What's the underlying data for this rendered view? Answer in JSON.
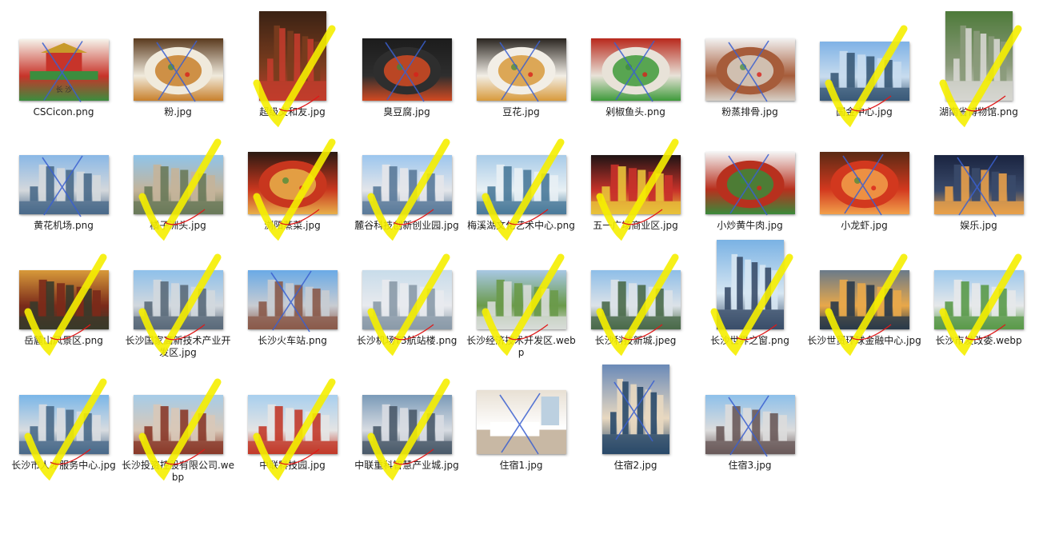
{
  "window": {
    "view": "large-icons"
  },
  "colors": {
    "highlight": "#f5ee00",
    "pen_blue": "#3a5fd0",
    "pen_red": "#e01818"
  },
  "files": [
    {
      "name": "CSCicon.png",
      "kind": "logo",
      "mark": "x",
      "colors": [
        "#f6f3ea",
        "#c7342a",
        "#3c8d3e"
      ]
    },
    {
      "name": "粉.jpg",
      "kind": "food",
      "mark": "x",
      "colors": [
        "#5a3a1e",
        "#f0eadc",
        "#c8802c"
      ]
    },
    {
      "name": "超级文和友.jpg",
      "kind": "tall",
      "mark": "check",
      "colors": [
        "#3a2214",
        "#7a3c1e",
        "#c23c2c"
      ]
    },
    {
      "name": "臭豆腐.jpg",
      "kind": "food",
      "mark": "x",
      "colors": [
        "#1c1c1c",
        "#2e2e2e",
        "#d24a22"
      ]
    },
    {
      "name": "豆花.jpg",
      "kind": "food",
      "mark": "x",
      "colors": [
        "#2a2520",
        "#f2eee6",
        "#d89a3c"
      ]
    },
    {
      "name": "剁椒鱼头.png",
      "kind": "food",
      "mark": "x",
      "colors": [
        "#b8281c",
        "#e8e2d8",
        "#3e9a3a"
      ]
    },
    {
      "name": "粉蒸排骨.jpg",
      "kind": "food",
      "mark": "x",
      "colors": [
        "#f2f2f2",
        "#a65c3a",
        "#d7d0c6"
      ]
    },
    {
      "name": "国金中心.jpg",
      "kind": "city",
      "mark": "check",
      "colors": [
        "#7fb2e6",
        "#c8dcee",
        "#3a5a78"
      ]
    },
    {
      "name": "湖南省博物馆.png",
      "kind": "tall",
      "mark": "check",
      "colors": [
        "#4e7a3a",
        "#8a9a7a",
        "#d6d6d0"
      ]
    },
    {
      "name": "黄花机场.png",
      "kind": "city",
      "mark": "x",
      "colors": [
        "#8ab8e6",
        "#d4d8dc",
        "#4a6a8a"
      ]
    },
    {
      "name": "橘子洲头.jpg",
      "kind": "city",
      "mark": "check",
      "colors": [
        "#8fc4ea",
        "#c4b49a",
        "#6a7a5a"
      ]
    },
    {
      "name": "浏阳蒸菜.jpg",
      "kind": "food",
      "mark": "check",
      "colors": [
        "#2a1a12",
        "#c8361e",
        "#e8b04a"
      ]
    },
    {
      "name": "麓谷科技创新创业园.jpg",
      "kind": "city",
      "mark": "check",
      "colors": [
        "#9cc6ee",
        "#e4e6ea",
        "#5a7a9a"
      ]
    },
    {
      "name": "梅溪湖文化艺术中心.png",
      "kind": "city",
      "mark": "check",
      "colors": [
        "#a8cbe8",
        "#e8f0f4",
        "#4a7a9a"
      ]
    },
    {
      "name": "五一广场商业区.jpg",
      "kind": "city",
      "mark": "check",
      "colors": [
        "#1e1414",
        "#c8322a",
        "#e8c23a"
      ]
    },
    {
      "name": "小炒黄牛肉.jpg",
      "kind": "food",
      "mark": "x",
      "colors": [
        "#f4f4f4",
        "#b8301e",
        "#3a8a3a"
      ]
    },
    {
      "name": "小龙虾.jpg",
      "kind": "food",
      "mark": "x",
      "colors": [
        "#5a2a14",
        "#d2381e",
        "#f2a04a"
      ]
    },
    {
      "name": "娱乐.jpg",
      "kind": "city",
      "mark": "x",
      "colors": [
        "#1a2440",
        "#3a4a6a",
        "#e8a04a"
      ]
    },
    {
      "name": "岳麓山风景区.png",
      "kind": "city",
      "mark": "check",
      "colors": [
        "#d89a3a",
        "#7a2a1a",
        "#3a3a2a"
      ]
    },
    {
      "name": "长沙国家高新技术产业开发区.jpg",
      "kind": "city",
      "mark": "check",
      "colors": [
        "#8ec0ea",
        "#d2d8de",
        "#5a6a7a"
      ]
    },
    {
      "name": "长沙火车站.png",
      "kind": "city",
      "mark": "x",
      "colors": [
        "#6aaae6",
        "#c8ccd2",
        "#8a5a4a"
      ]
    },
    {
      "name": "长沙机场T3航站楼.png",
      "kind": "city",
      "mark": "check",
      "colors": [
        "#c8dcea",
        "#e8eaee",
        "#8a9aa8"
      ]
    },
    {
      "name": "长沙经济技术开发区.webp",
      "kind": "city",
      "mark": "check",
      "colors": [
        "#a8c8e4",
        "#6a9a4a",
        "#d8dcd8"
      ]
    },
    {
      "name": "长沙科技新城.jpeg",
      "kind": "city",
      "mark": "check",
      "colors": [
        "#8ebee8",
        "#dce2e8",
        "#4a6a4a"
      ]
    },
    {
      "name": "长沙世界之窗.png",
      "kind": "tall",
      "mark": "check",
      "colors": [
        "#7ab2e4",
        "#d6e6f2",
        "#3a4e6a"
      ]
    },
    {
      "name": "长沙世贸环球金融中心.jpg",
      "kind": "city",
      "mark": "check",
      "colors": [
        "#6a7a8a",
        "#e8a84a",
        "#2a3a4a"
      ]
    },
    {
      "name": "长沙市发改委.webp",
      "kind": "city",
      "mark": "check",
      "colors": [
        "#9cc8ec",
        "#e6e8ea",
        "#5a9a4a"
      ]
    },
    {
      "name": "长沙市人才服务中心.jpg",
      "kind": "city",
      "mark": "check",
      "colors": [
        "#7ab6e8",
        "#d8dce0",
        "#4a6a8a"
      ]
    },
    {
      "name": "长沙投资控股有限公司.webp",
      "kind": "city",
      "mark": "check",
      "colors": [
        "#a6cce8",
        "#d8c8b8",
        "#8a3a2a"
      ]
    },
    {
      "name": "中联科技园.jpg",
      "kind": "city",
      "mark": "check",
      "colors": [
        "#a8cfee",
        "#e4e4e4",
        "#c23a2a"
      ]
    },
    {
      "name": "中联重科智慧产业城.jpg",
      "kind": "city",
      "mark": "check",
      "colors": [
        "#7a9ab8",
        "#d8dce2",
        "#4a5a6a"
      ]
    },
    {
      "name": "住宿1.jpg",
      "kind": "room",
      "mark": "x",
      "colors": [
        "#e8e0d4",
        "#ffffff",
        "#8a7a6a"
      ]
    },
    {
      "name": "住宿2.jpg",
      "kind": "tall",
      "mark": "x",
      "colors": [
        "#6a8ab8",
        "#e8d8c0",
        "#2a4a6a"
      ]
    },
    {
      "name": "住宿3.jpg",
      "kind": "city",
      "mark": "x",
      "colors": [
        "#8ec0ea",
        "#dcdcdc",
        "#6a5a5a"
      ]
    }
  ]
}
